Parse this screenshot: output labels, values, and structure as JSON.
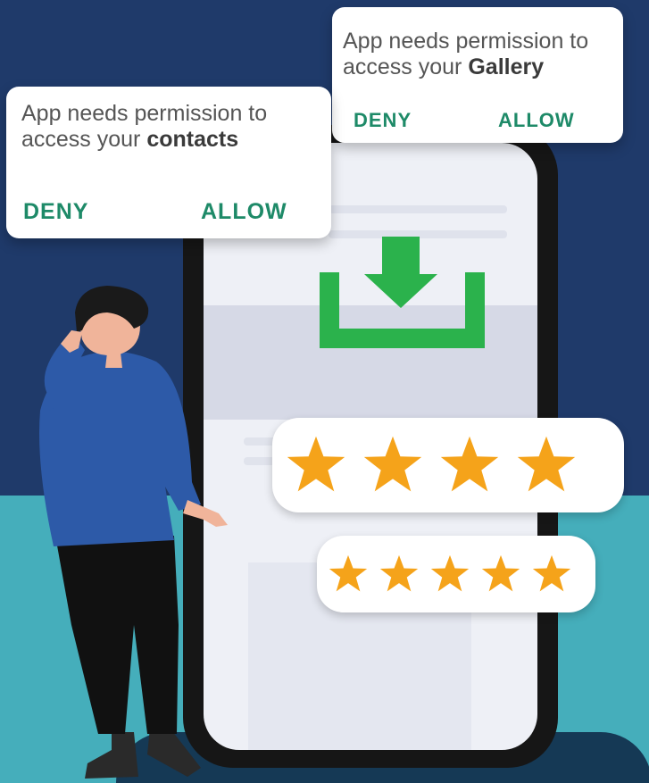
{
  "dialog_contacts": {
    "message_prefix": "App needs permission to access your",
    "message_bold": "contacts",
    "deny_label": "DENY",
    "allow_label": "ALLOW"
  },
  "dialog_gallery": {
    "message_prefix": "App needs permission to access your",
    "message_bold": "Gallery",
    "deny_label": "DENY",
    "allow_label": "ALLOW"
  },
  "ratings": [
    {
      "stars": 4,
      "max_stars": 4
    },
    {
      "stars": 5,
      "max_stars": 5
    }
  ],
  "icons": [
    "download-icon",
    "star-icon",
    "person-illustration",
    "smartphone-illustration"
  ],
  "colors": {
    "background": "#1f3a6a",
    "floor": "#45aebb",
    "accent_green": "#2bb24c",
    "button_text": "#1e8a68",
    "star": "#f5a31a"
  }
}
